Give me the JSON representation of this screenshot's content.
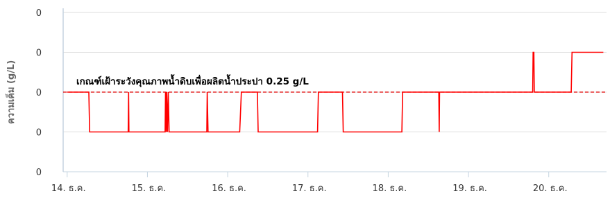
{
  "chart_data": {
    "type": "line",
    "ylabel": "ความเค็ม (g/L)",
    "y_tick_labels": [
      "0",
      "0",
      "0",
      "0",
      "0"
    ],
    "y_tick_values": [
      0,
      0.125,
      0.25,
      0.375,
      0.5
    ],
    "ylim": [
      0,
      0.5
    ],
    "x_tick_labels": [
      "14. ธ.ค.",
      "15. ธ.ค.",
      "16. ธ.ค.",
      "17. ธ.ค.",
      "18. ธ.ค.",
      "19. ธ.ค.",
      "20. ธ.ค."
    ],
    "x_tick_values": [
      14,
      15,
      16,
      17,
      18,
      19,
      20
    ],
    "xlim": [
      13.95,
      20.72
    ],
    "grid": "horizontal",
    "threshold": {
      "value": 0.25,
      "label": "เกณฑ์เฝ้าระวังคุณภาพน้ำดิบเพื่อผลิตน้ำประปา 0.25 g/L",
      "color": "#e00000",
      "style": "dashed"
    },
    "series": [
      {
        "color": "#ff0000",
        "points": [
          [
            14.0,
            0.25
          ],
          [
            14.27,
            0.25
          ],
          [
            14.28,
            0.125
          ],
          [
            14.76,
            0.125
          ],
          [
            14.765,
            0.25
          ],
          [
            14.77,
            0.125
          ],
          [
            15.22,
            0.125
          ],
          [
            15.225,
            0.25
          ],
          [
            15.235,
            0.125
          ],
          [
            15.24,
            0.25
          ],
          [
            15.25,
            0.125
          ],
          [
            15.26,
            0.25
          ],
          [
            15.27,
            0.125
          ],
          [
            15.74,
            0.125
          ],
          [
            15.745,
            0.25
          ],
          [
            15.755,
            0.125
          ],
          [
            16.15,
            0.125
          ],
          [
            16.17,
            0.25
          ],
          [
            16.37,
            0.25
          ],
          [
            16.38,
            0.125
          ],
          [
            17.12,
            0.125
          ],
          [
            17.13,
            0.25
          ],
          [
            17.43,
            0.25
          ],
          [
            17.44,
            0.125
          ],
          [
            18.17,
            0.125
          ],
          [
            18.18,
            0.25
          ],
          [
            18.63,
            0.25
          ],
          [
            18.635,
            0.125
          ],
          [
            18.64,
            0.25
          ],
          [
            19.8,
            0.25
          ],
          [
            19.805,
            0.375
          ],
          [
            19.815,
            0.375
          ],
          [
            19.82,
            0.25
          ],
          [
            20.28,
            0.25
          ],
          [
            20.29,
            0.375
          ],
          [
            20.68,
            0.375
          ]
        ]
      }
    ]
  }
}
